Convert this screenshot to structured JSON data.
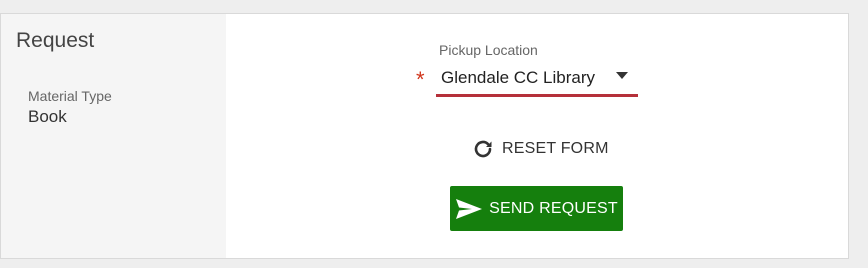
{
  "sidebar": {
    "title": "Request",
    "material_type_label": "Material Type",
    "material_type_value": "Book"
  },
  "form": {
    "pickup_label": "Pickup Location",
    "required_marker": "*",
    "pickup_value": "Glendale CC Library",
    "reset_label": "RESET FORM",
    "reset_icon": "refresh-icon",
    "send_label": "SEND REQUEST",
    "send_icon": "send-icon"
  },
  "colors": {
    "send_button": "#157f0d",
    "select_underline": "#b5303a",
    "required_star": "#d0351b"
  }
}
